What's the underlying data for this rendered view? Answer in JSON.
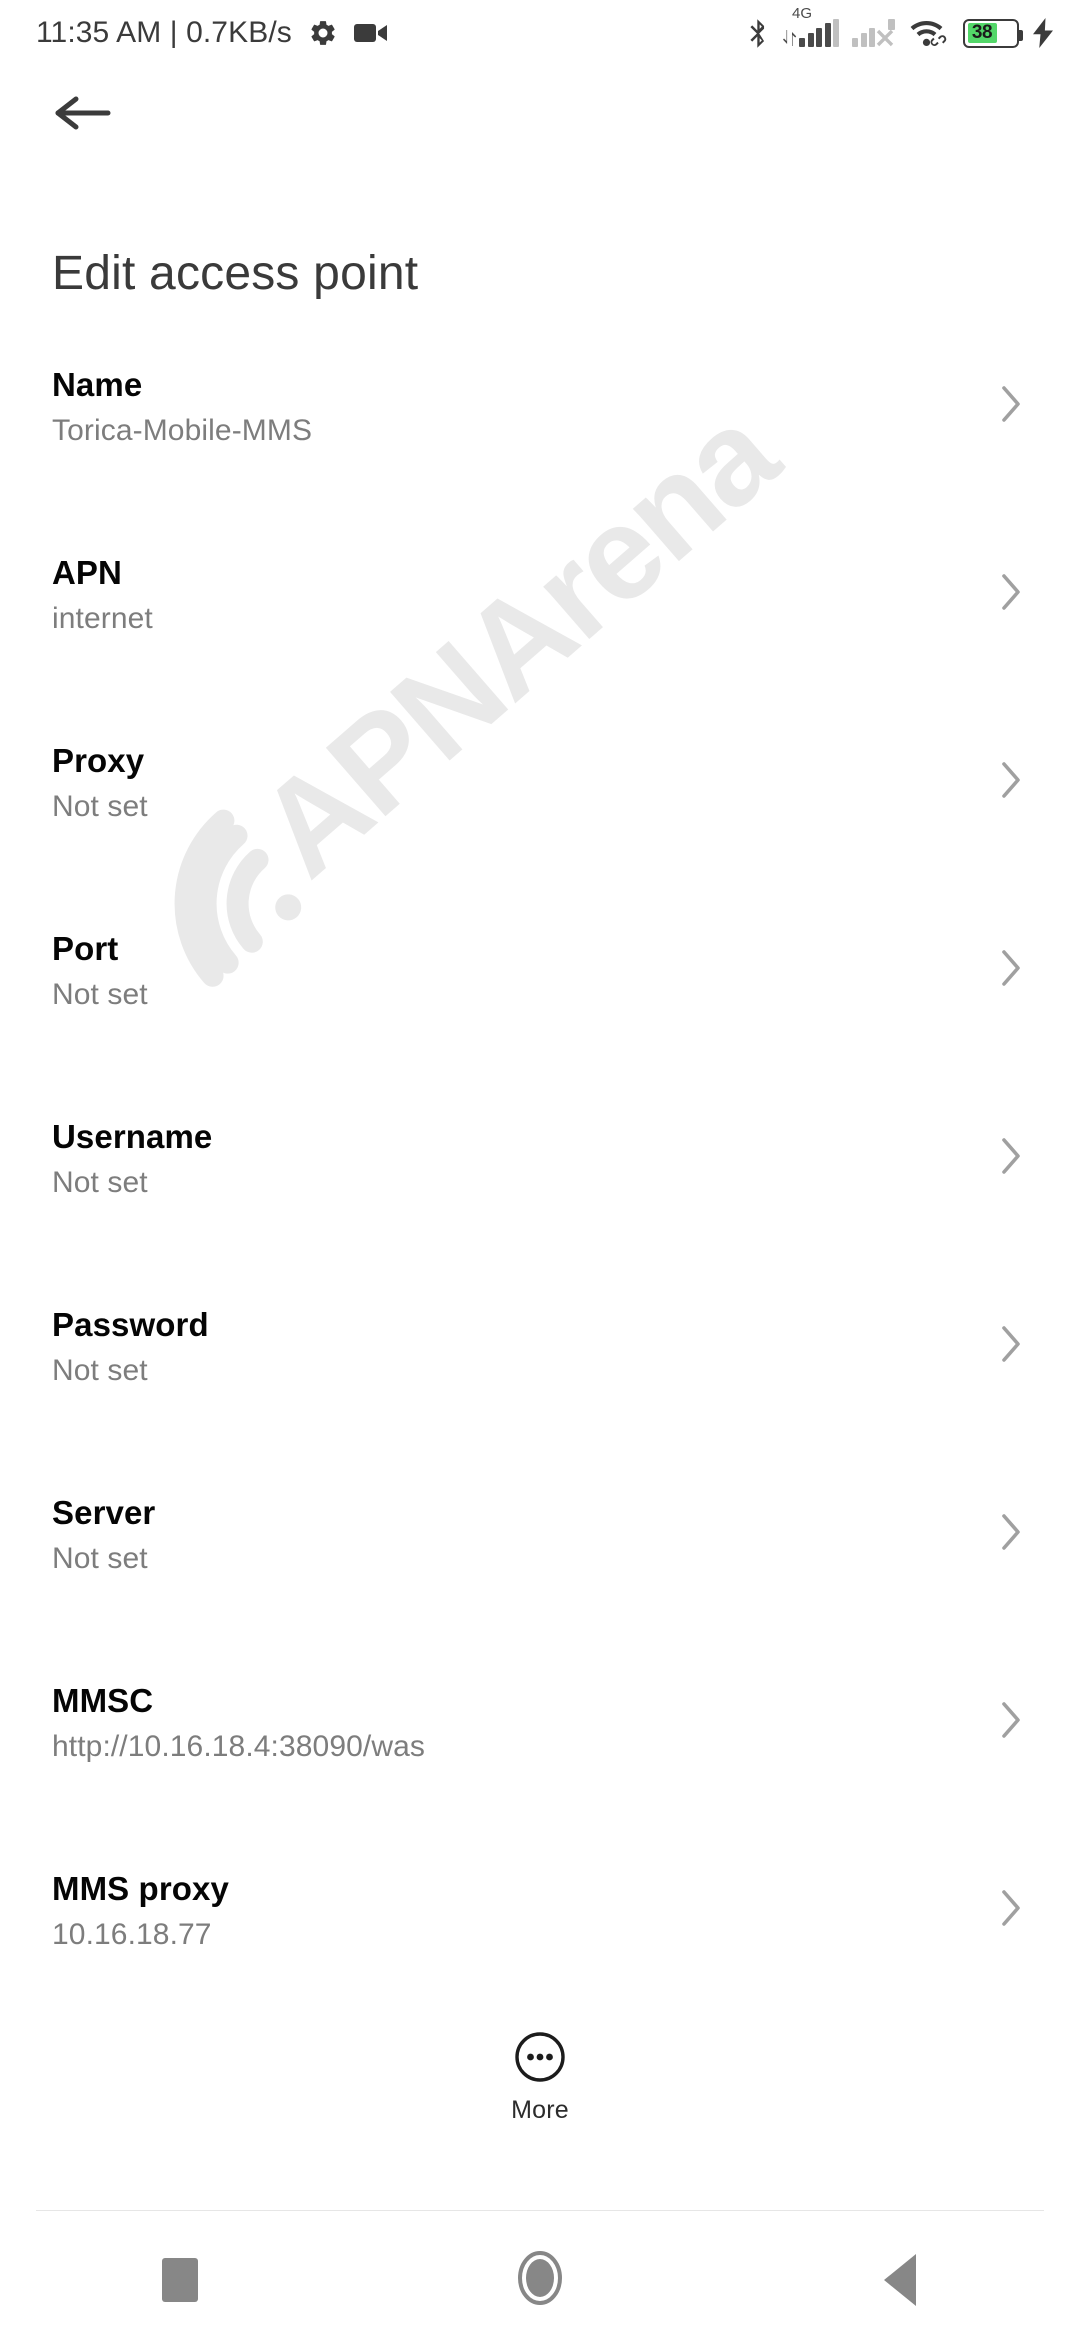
{
  "status_bar": {
    "clock_and_net": "11:35 AM | 0.7KB/s",
    "icons": [
      "gear-icon",
      "video-recording-icon",
      "bluetooth-icon",
      "signal-4g-icon",
      "signal-sim2-no-service-icon",
      "wifi-icon",
      "battery-icon",
      "charging-bolt-icon"
    ],
    "network_type": "4G",
    "battery_percent": "38",
    "battery_color": "#53d769"
  },
  "header": {
    "back_icon": "arrow-left-icon",
    "title": "Edit access point"
  },
  "watermark": {
    "text": "APNArena",
    "color": "#e9e9e9",
    "logo_icon": "wifi-arc-icon"
  },
  "settings_list": {
    "chevron_icon": "chevron-right-icon",
    "items": [
      {
        "label": "Name",
        "value": "Torica-Mobile-MMS"
      },
      {
        "label": "APN",
        "value": "internet"
      },
      {
        "label": "Proxy",
        "value": "Not set"
      },
      {
        "label": "Port",
        "value": "Not set"
      },
      {
        "label": "Username",
        "value": "Not set"
      },
      {
        "label": "Password",
        "value": "Not set"
      },
      {
        "label": "Server",
        "value": "Not set"
      },
      {
        "label": "MMSC",
        "value": "http://10.16.18.4:38090/was"
      },
      {
        "label": "MMS proxy",
        "value": "10.16.18.77"
      }
    ]
  },
  "more_button": {
    "label": "More",
    "icon": "overflow-dots-circle-icon"
  },
  "nav_bar": {
    "recents_icon": "square-recents-icon",
    "home_icon": "circle-home-icon",
    "back_icon": "triangle-back-icon"
  }
}
